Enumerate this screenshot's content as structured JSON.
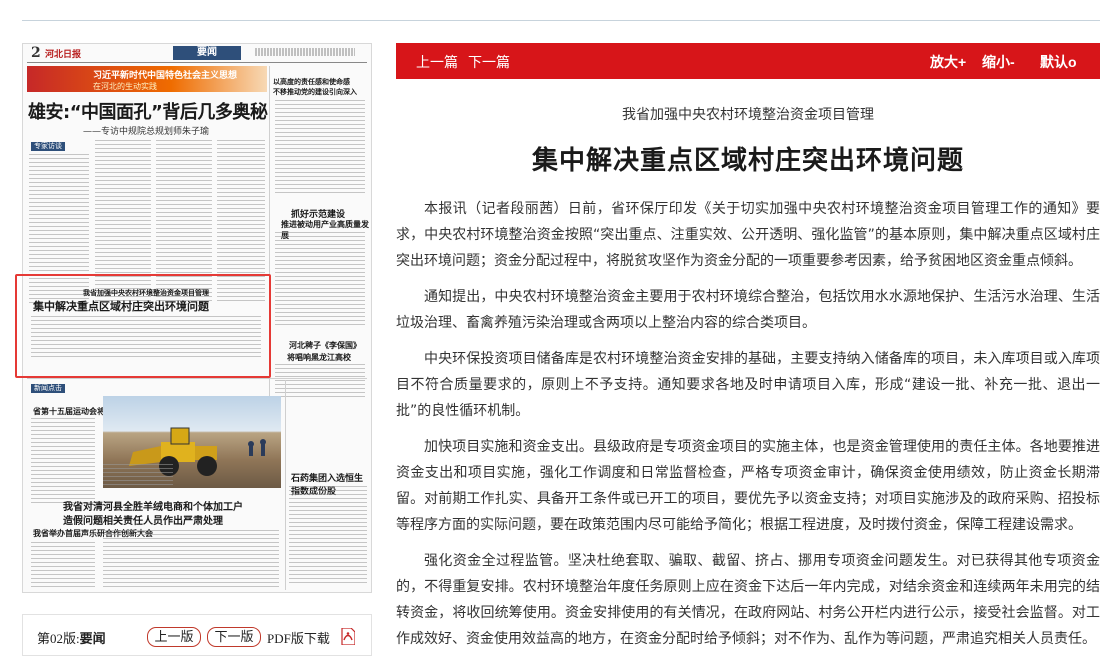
{
  "newspaper_page": {
    "page_number": "2",
    "paper_name": "河北日报",
    "section": "要闻",
    "banner_title": "习近平新时代中国特色社会主义思想",
    "banner_subtitle": "在河北的生动实践",
    "headline": "雄安:“中国面孔”背后几多奥秘",
    "subheadline": "——专访中规院总规划师朱子瑜",
    "right_col_title_1": "以高度的责任感和使命感",
    "right_col_title_2": "不移推动党的建设引向深入",
    "mid_right_title_1": "抓好示范建设",
    "mid_right_title_2": "推进被动用产业高质量发展",
    "low_right_title_1": "河北稗子《李保国》",
    "low_right_title_2": "将唱响黑龙江高校",
    "selected_article_kicker": "我省加强中央农村环境整治资金项目管理",
    "selected_article_title": "集中解决重点区域村庄突出环境问题",
    "tag_1": "专家访谈",
    "tag_2": "新闻点击",
    "side_title_1": "省第十五届运动会将于9月8日举行",
    "side_title_2": "我省举办首届声乐研合作创新大会",
    "right_side_title": "石药集团入选恒生指数成份股",
    "bottom_title_1": "我省对清河县全胜羊绒电商和个体加工户",
    "bottom_title_2": "造假问题相关责任人员作出严肃处理"
  },
  "pager": {
    "edition_prefix": "第02版:",
    "edition_name": "要闻",
    "prev_label": "上一版",
    "next_label": "下一版",
    "pdf_label": "PDF版下载",
    "pdf_icon": "pdf-icon"
  },
  "toolbar": {
    "prev_article": "上一篇",
    "next_article": "下一篇",
    "zoom_in": "放大+",
    "zoom_out": "缩小-",
    "default": "默认o",
    "bg_color": "#d71519"
  },
  "article": {
    "intro": "我省加强中央农村环境整治资金项目管理",
    "title": "集中解决重点区域村庄突出环境问题",
    "paragraphs": [
      "本报讯（记者段丽茜）日前，省环保厅印发《关于切实加强中央农村环境整治资金项目管理工作的通知》要求，中央农村环境整治资金按照“突出重点、注重实效、公开透明、强化监管”的基本原则，集中解决重点区域村庄突出环境问题；资金分配过程中，将脱贫攻坚作为资金分配的一项重要参考因素，给予贫困地区资金重点倾斜。",
      "通知提出，中央农村环境整治资金主要用于农村环境综合整治，包括饮用水水源地保护、生活污水治理、生活垃圾治理、畜禽养殖污染治理或含两项以上整治内容的综合类项目。",
      "中央环保投资项目储备库是农村环境整治资金安排的基础，主要支持纳入储备库的项目，未入库项目或入库项目不符合质量要求的，原则上不予支持。通知要求各地及时申请项目入库，形成“建设一批、补充一批、退出一批”的良性循环机制。",
      "加快项目实施和资金支出。县级政府是专项资金项目的实施主体，也是资金管理使用的责任主体。各地要推进资金支出和项目实施，强化工作调度和日常监督检查，严格专项资金审计，确保资金使用绩效，防止资金长期滞留。对前期工作扎实、具备开工条件或已开工的项目，要优先予以资金支持；对项目实施涉及的政府采购、招投标等程序方面的实际问题，要在政策范围内尽可能给予简化；根据工程进度，及时拨付资金，保障工程建设需求。",
      "强化资金全过程监管。坚决杜绝套取、骗取、截留、挤占、挪用专项资金问题发生。对已获得其他专项资金的，不得重复安排。农村环境整治年度任务原则上应在资金下达后一年内完成，对结余资金和连续两年未用完的结转资金，将收回统筹使用。资金安排使用的有关情况，在政府网站、村务公开栏内进行公示，接受社会监督。对工作成效好、资金使用效益高的地方，在资金分配时给予倾斜；对不作为、乱作为等问题，严肃追究相关人员责任。"
    ]
  }
}
